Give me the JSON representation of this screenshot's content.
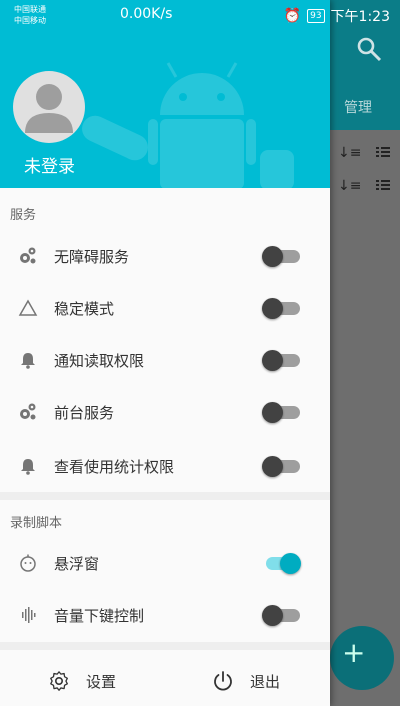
{
  "status_bar": {
    "carrier_1": "中国联通",
    "carrier_2": "中国移动",
    "net_speed": "0.00K/s",
    "battery": "93",
    "time": "下午1:23"
  },
  "background_app": {
    "tab_label": "管理",
    "fab_label": "+"
  },
  "drawer": {
    "user_name": "未登录",
    "sections": {
      "services_title": "服务",
      "recording_title": "录制脚本"
    },
    "services": [
      {
        "label": "无障碍服务",
        "icon": "gears-icon",
        "on": false
      },
      {
        "label": "稳定模式",
        "icon": "triangle-icon",
        "on": false
      },
      {
        "label": "通知读取权限",
        "icon": "bell-icon",
        "on": false
      },
      {
        "label": "前台服务",
        "icon": "gears-icon",
        "on": false
      },
      {
        "label": "查看使用统计权限",
        "icon": "bell-icon",
        "on": false
      }
    ],
    "recording": [
      {
        "label": "悬浮窗",
        "icon": "face-icon",
        "on": true
      },
      {
        "label": "音量下键控制",
        "icon": "waveform-icon",
        "on": false
      }
    ],
    "bottom": {
      "settings_label": "设置",
      "exit_label": "退出"
    }
  },
  "colors": {
    "accent": "#00bcd4",
    "switch_on": "#00acc1"
  }
}
